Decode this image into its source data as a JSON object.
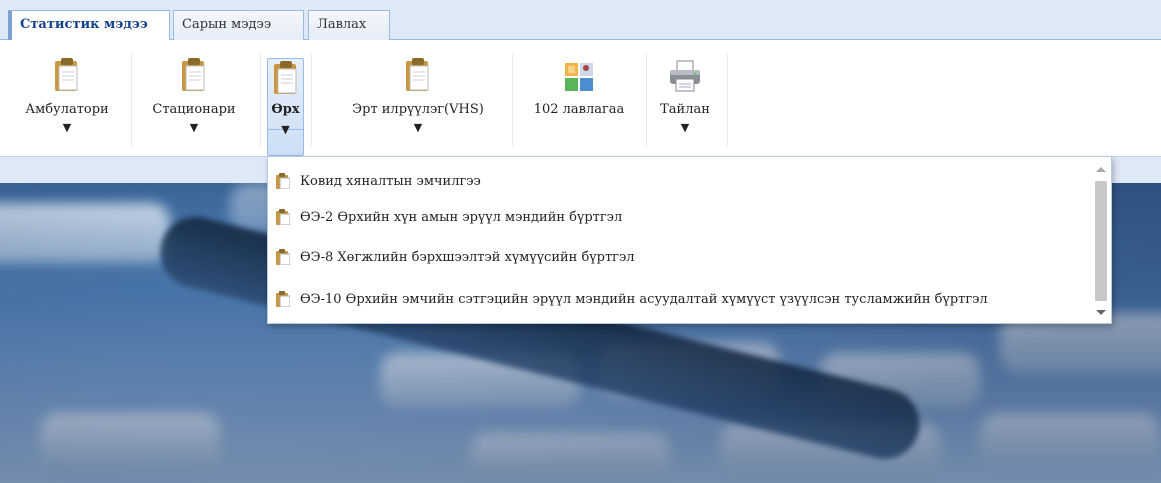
{
  "tabs": [
    {
      "label": "Статистик мэдээ",
      "active": true
    },
    {
      "label": "Сарын мэдээ",
      "active": false
    },
    {
      "label": "Лавлах",
      "active": false
    }
  ],
  "toolbar": {
    "buttons": [
      {
        "label": "Амбулатори",
        "icon": "clipboard-icon",
        "has_dropdown": true
      },
      {
        "label": "Стационари",
        "icon": "clipboard-icon",
        "has_dropdown": true
      },
      {
        "label": "Өрх",
        "icon": "clipboard-icon",
        "has_dropdown": true,
        "pressed": true
      },
      {
        "label": "Эрт илрүүлэг(VHS)",
        "icon": "clipboard-icon",
        "has_dropdown": true
      },
      {
        "label": "102 лавлагаа",
        "icon": "grid-icon",
        "has_dropdown": false
      },
      {
        "label": "Тайлан",
        "icon": "printer-icon",
        "has_dropdown": true
      }
    ],
    "caret": "▼"
  },
  "menu": {
    "items": [
      {
        "label": "Ковид хяналтын эмчилгээ"
      },
      {
        "label": "ӨЭ-2 Өрхийн хүн амын эрүүл мэндийн бүртгэл"
      },
      {
        "label": "ӨЭ-8 Хөгжлийн бэрхшээлтэй хүмүүсийн бүртгэл"
      },
      {
        "label": "ӨЭ-10 Өрхийн эмчийн сэтгэцийн эрүүл мэндийн асуудалтай хүмүүст үзүүлсэн тусламжийн бүртгэл"
      }
    ]
  },
  "colors": {
    "tab_strip": "#dfe8f6",
    "active_tab_text": "#15428b",
    "border": "#99bbe8"
  }
}
